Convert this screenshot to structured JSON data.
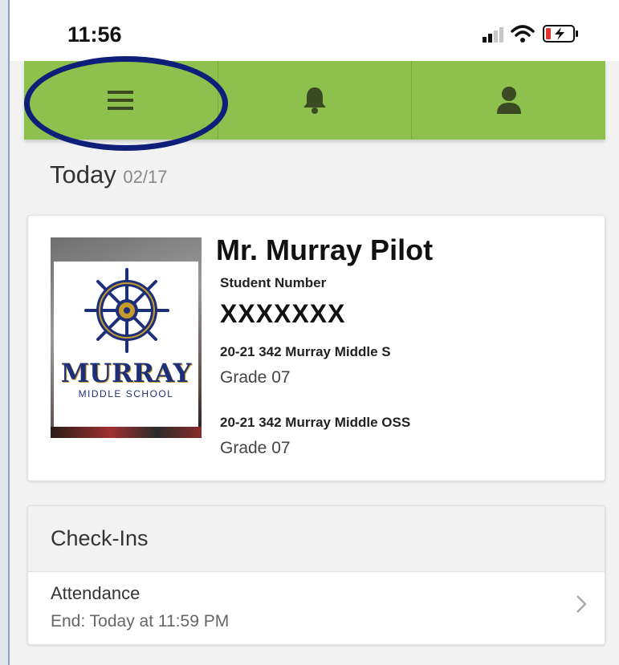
{
  "status_bar": {
    "time": "11:56",
    "icons": [
      "signal-icon",
      "wifi-icon",
      "battery-charging-icon"
    ]
  },
  "toolbar": {
    "buttons": [
      {
        "icon": "hamburger-menu-icon"
      },
      {
        "icon": "bell-icon"
      },
      {
        "icon": "user-icon"
      }
    ],
    "color": "#8dc04c"
  },
  "today": {
    "label": "Today",
    "date": "02/17"
  },
  "profile": {
    "name": "Mr. Murray Pilot",
    "student_number_label": "Student Number",
    "student_number": "XXXXXXX",
    "logo": {
      "word": "MURRAY",
      "sub": "MIDDLE SCHOOL"
    },
    "enrollments": [
      {
        "school": "20-21 342 Murray Middle S",
        "grade": "Grade 07"
      },
      {
        "school": "20-21 342 Murray Middle OSS",
        "grade": "Grade 07"
      }
    ]
  },
  "checkins": {
    "title": "Check-Ins",
    "items": [
      {
        "title": "Attendance",
        "subtitle": "End: Today at 11:59 PM"
      }
    ]
  },
  "colors": {
    "accent": "#8dc04c",
    "highlight_ring": "#0d1f78",
    "logo_blue": "#1e2f7a",
    "logo_gold": "#c79b2b"
  }
}
